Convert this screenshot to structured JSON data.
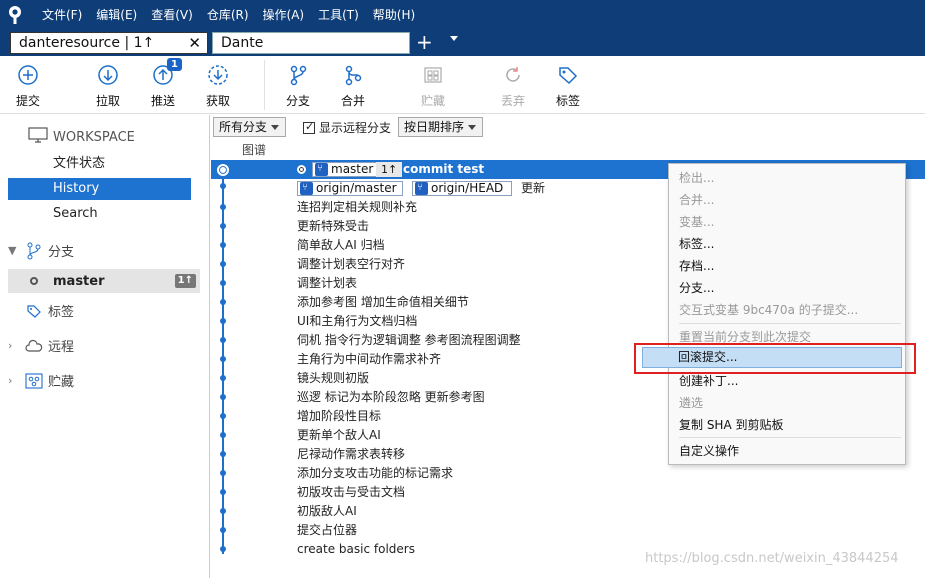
{
  "menu": [
    "文件(F)",
    "编辑(E)",
    "查看(V)",
    "仓库(R)",
    "操作(A)",
    "工具(T)",
    "帮助(H)"
  ],
  "tabs": {
    "active": "danteresource | 1↑",
    "second": "Dante",
    "close": "✕",
    "add": "+"
  },
  "toolbar": {
    "commit": "提交",
    "pull": "拉取",
    "push": "推送",
    "push_badge": "1",
    "fetch": "获取",
    "branch": "分支",
    "merge": "合并",
    "stash": "贮藏",
    "discard": "丢弃",
    "tag": "标签"
  },
  "sidebar": {
    "workspace": "WORKSPACE",
    "file_status": "文件状态",
    "history": "History",
    "search": "Search",
    "branches": "分支",
    "master": "master",
    "master_ahead": "1↑",
    "tags": "标签",
    "remote": "远程",
    "stashes": "贮藏"
  },
  "filter": {
    "all_branches": "所有分支",
    "show_remote": "显示远程分支",
    "sort": "按日期排序",
    "graph_header": "图谱"
  },
  "commits": {
    "head_branch": "master",
    "head_ahead": "1↑",
    "head_message": "commit test",
    "origin_master": "origin/master",
    "origin_head": "origin/HEAD",
    "second_message": "更新",
    "messages": [
      "连招判定相关规则补充",
      "更新特殊受击",
      "简单敌人AI 归档",
      "调整计划表空行对齐",
      "调整计划表",
      "添加参考图 增加生命值相关细节",
      "UI和主角行为文档归档",
      "伺机 指令行为逻辑调整 参考图流程图调整",
      "主角行为中间动作需求补齐",
      "镜头规则初版",
      "巡逻 标记为本阶段忽略 更新参考图",
      "增加阶段性目标",
      "更新单个敌人AI",
      "尼禄动作需求表转移",
      "添加分支攻击功能的标记需求",
      "初版攻击与受击文档",
      "初版敌人AI",
      "提交占位器",
      "create basic folders"
    ]
  },
  "context_menu": {
    "checkout": "检出...",
    "merge": "合并...",
    "rebase": "变基...",
    "tag": "标签...",
    "archive": "存档...",
    "branch": "分支...",
    "interactive_rebase": "交互式变基 9bc470a 的子提交...",
    "reset": "重置当前分支到此次提交",
    "revert": "回滚提交...",
    "patch": "创建补丁...",
    "cherry_pick": "遴选",
    "copy_sha": "复制 SHA 到剪贴板",
    "custom": "自定义操作"
  },
  "watermark": "https://blog.csdn.net/weixin_43844254",
  "colors": {
    "titlebar": "#0e3d78",
    "accent": "#1e73d0",
    "graph": "#1e6fcc",
    "highlight_box": "#e02020"
  }
}
